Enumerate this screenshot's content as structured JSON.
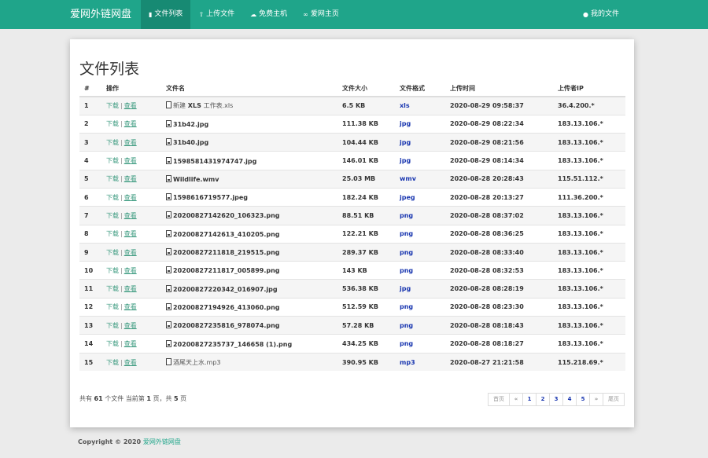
{
  "nav": {
    "brand": "爱网外链网盘",
    "items": [
      {
        "label": "文件列表",
        "icon": "folder-icon"
      },
      {
        "label": "上传文件",
        "icon": "upload-icon"
      },
      {
        "label": "免费主机",
        "icon": "cloud-icon"
      },
      {
        "label": "爱网主页",
        "icon": "link-icon"
      }
    ],
    "my_files": "我的文件"
  },
  "page": {
    "title": "文件列表"
  },
  "table": {
    "headers": [
      "#",
      "操作",
      "文件名",
      "文件大小",
      "文件格式",
      "上传时间",
      "上传者IP"
    ],
    "download_label": "下载",
    "view_label": "查看",
    "rows": [
      {
        "n": "1",
        "name_prefix": "新建",
        "name": "XLS",
        "name_suffix": "工作表.xls",
        "size": "6.5 KB",
        "fmt": "xls",
        "time": "2020-08-29 09:58:37",
        "ip": "36.4.200.*"
      },
      {
        "n": "2",
        "name": "31b42.jpg",
        "size": "111.38 KB",
        "fmt": "jpg",
        "time": "2020-08-29 08:22:34",
        "ip": "183.13.106.*"
      },
      {
        "n": "3",
        "name": "31b40.jpg",
        "size": "104.44 KB",
        "fmt": "jpg",
        "time": "2020-08-29 08:21:56",
        "ip": "183.13.106.*"
      },
      {
        "n": "4",
        "name": "1598581431974747.jpg",
        "size": "146.01 KB",
        "fmt": "jpg",
        "time": "2020-08-29 08:14:34",
        "ip": "183.13.106.*"
      },
      {
        "n": "5",
        "name": "Wildlife.wmv",
        "size": "25.03 MB",
        "fmt": "wmv",
        "time": "2020-08-28 20:28:43",
        "ip": "115.51.112.*"
      },
      {
        "n": "6",
        "name": "1598616719577.jpeg",
        "size": "182.24 KB",
        "fmt": "jpeg",
        "time": "2020-08-28 20:13:27",
        "ip": "111.36.200.*"
      },
      {
        "n": "7",
        "name": "20200827142620_106323.png",
        "size": "88.51 KB",
        "fmt": "png",
        "time": "2020-08-28 08:37:02",
        "ip": "183.13.106.*"
      },
      {
        "n": "8",
        "name": "20200827142613_410205.png",
        "size": "122.21 KB",
        "fmt": "png",
        "time": "2020-08-28 08:36:25",
        "ip": "183.13.106.*"
      },
      {
        "n": "9",
        "name": "20200827211818_219515.png",
        "size": "289.37 KB",
        "fmt": "png",
        "time": "2020-08-28 08:33:40",
        "ip": "183.13.106.*"
      },
      {
        "n": "10",
        "name": "20200827211817_005899.png",
        "size": "143 KB",
        "fmt": "png",
        "time": "2020-08-28 08:32:53",
        "ip": "183.13.106.*"
      },
      {
        "n": "11",
        "name": "20200827220342_016907.jpg",
        "size": "536.38 KB",
        "fmt": "jpg",
        "time": "2020-08-28 08:28:19",
        "ip": "183.13.106.*"
      },
      {
        "n": "12",
        "name": "20200827194926_413060.png",
        "size": "512.59 KB",
        "fmt": "png",
        "time": "2020-08-28 08:23:30",
        "ip": "183.13.106.*"
      },
      {
        "n": "13",
        "name": "20200827235816_978074.png",
        "size": "57.28 KB",
        "fmt": "png",
        "time": "2020-08-28 08:18:43",
        "ip": "183.13.106.*"
      },
      {
        "n": "14",
        "name": "20200827235737_146658 (1).png",
        "size": "434.25 KB",
        "fmt": "png",
        "time": "2020-08-28 08:18:27",
        "ip": "183.13.106.*"
      },
      {
        "n": "15",
        "name_prefix": "酒尾天上水.mp3",
        "name": "",
        "size": "390.95 KB",
        "fmt": "mp3",
        "time": "2020-08-27 21:21:58",
        "ip": "115.218.69.*"
      }
    ]
  },
  "summary": {
    "p1": "共有",
    "total": "61",
    "p2": "个文件 当前第",
    "page": "1",
    "p3": "页，共",
    "pages": "5",
    "p4": "页"
  },
  "pager": {
    "first": "首页",
    "prev": "«",
    "pages": [
      "1",
      "2",
      "3",
      "4",
      "5"
    ],
    "next": "»",
    "last": "尾页"
  },
  "footer": {
    "copyright": "Copyright © 2020",
    "link": "爱网外链网盘"
  },
  "colors": {
    "nav": "#1fa58a",
    "nav_active": "#178a73",
    "link": "#3d9b80",
    "format": "#1a37b0"
  }
}
